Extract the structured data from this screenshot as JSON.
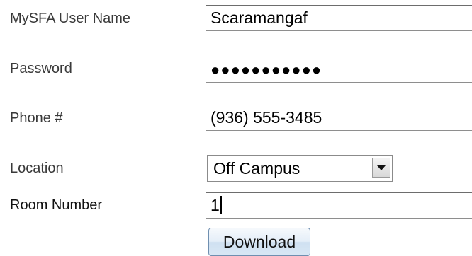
{
  "form": {
    "username": {
      "label": "MySFA User Name",
      "value": "Scaramangaf"
    },
    "password": {
      "label": "Password",
      "value": "●●●●●●●●●●●"
    },
    "phone": {
      "label": "Phone #",
      "value": "(936) 555-3485"
    },
    "location": {
      "label": "Location",
      "selected": "Off Campus",
      "icon": "chevron-down-icon"
    },
    "room": {
      "label": "Room Number",
      "value": "1"
    },
    "download_label": "Download"
  }
}
